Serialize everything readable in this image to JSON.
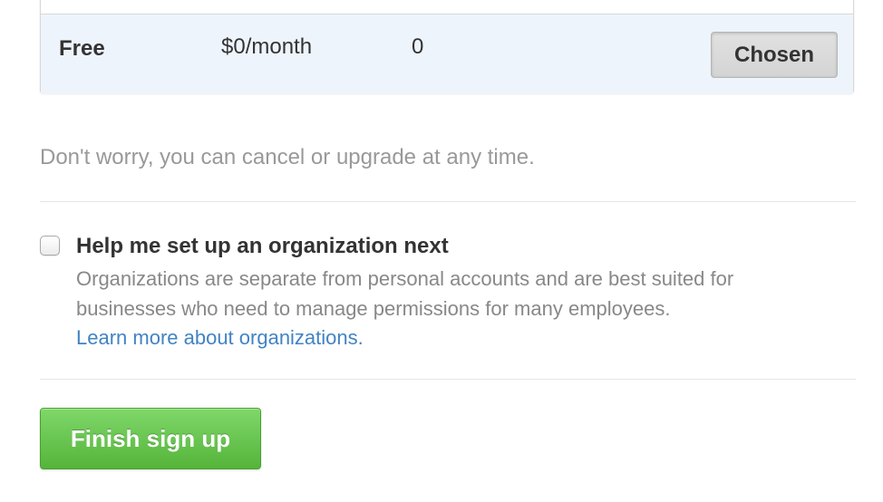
{
  "plan_table": {
    "selected_plan": {
      "name": "Free",
      "price": "$0/month",
      "repos": "0",
      "button_label": "Chosen"
    }
  },
  "note": "Don't worry, you can cancel or upgrade at any time.",
  "organization": {
    "checkbox_checked": false,
    "title": "Help me set up an organization next",
    "description": "Organizations are separate from personal accounts and are best suited for businesses who need to manage permissions for many employees.",
    "link_text": "Learn more about organizations."
  },
  "finish_button_label": "Finish sign up",
  "colors": {
    "link": "#4183c4",
    "finish_button": "#5cb842",
    "selected_row": "#eef4fc"
  }
}
